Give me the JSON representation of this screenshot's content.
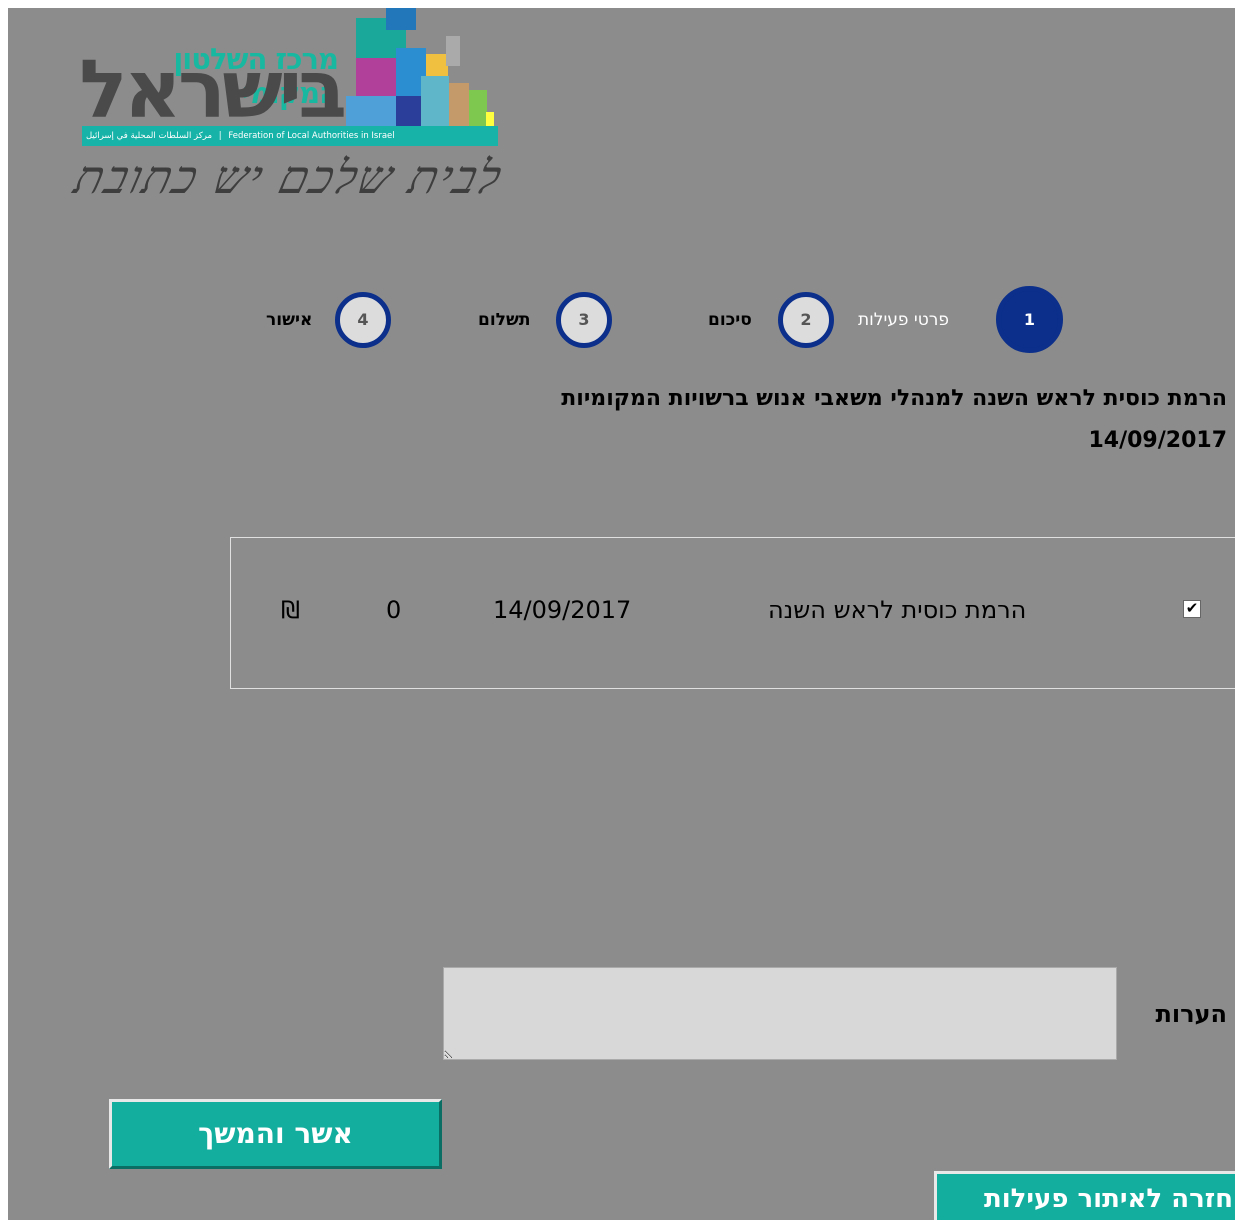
{
  "logo": {
    "hebrew_top": "מרכז השלטון המקומי",
    "hebrew_main": "בישראל",
    "band_arabic": "مركز السلطات المحلية في إسرائيل",
    "band_english": "Federation of Local Authorities in Israel",
    "slogan": "לבית שלכם יש כתובת"
  },
  "steps": [
    {
      "number": "1",
      "label": "פרטי פעילות",
      "active": true
    },
    {
      "number": "2",
      "label": "סיכום",
      "active": false
    },
    {
      "number": "3",
      "label": "תשלום",
      "active": false
    },
    {
      "number": "4",
      "label": "אישור",
      "active": false
    }
  ],
  "activity": {
    "title": "הרמת כוסית לראש השנה למנהלי משאבי אנוש ברשויות המקומיות",
    "date": "14/09/2017",
    "row": {
      "checked": true,
      "name": "הרמת כוסית לראש השנה",
      "date": "14/09/2017",
      "price": "0",
      "currency": "₪"
    }
  },
  "comments": {
    "label": "הערות",
    "value": ""
  },
  "buttons": {
    "confirm": "אשר והמשך",
    "back": "חזרה לאיתור פעילות"
  },
  "colors": {
    "background": "#8c8c8c",
    "step_blue": "#0b2f8a",
    "button_teal": "#14ae9f"
  }
}
